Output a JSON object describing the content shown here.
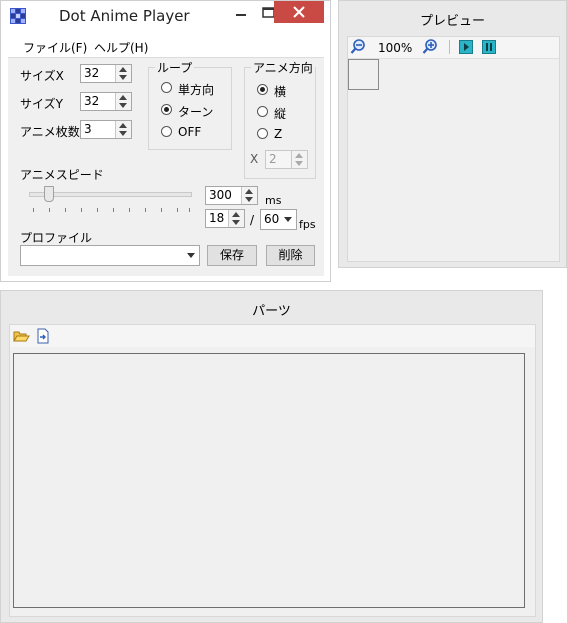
{
  "main": {
    "title": "Dot Anime Player",
    "menu": [
      "ファイル(F)",
      "ヘルプ(H)"
    ],
    "size_x_label": "サイズX",
    "size_x_value": "32",
    "size_y_label": "サイズY",
    "size_y_value": "32",
    "frames_label": "アニメ枚数",
    "frames_value": "3",
    "loop": {
      "title": "ループ",
      "options": [
        "単方向",
        "ターン",
        "OFF"
      ],
      "selected": "ターン"
    },
    "direction": {
      "title": "アニメ方向",
      "options": [
        "横",
        "縦",
        "Z"
      ],
      "selected": "横",
      "x_label": "X",
      "x_value": "2"
    },
    "speed_label": "アニメスピード",
    "ms_value": "300",
    "ms_unit": "ms",
    "frames_per": "18",
    "slash": "/",
    "fps_select": "60",
    "fps_unit": "fps",
    "profile_label": "プロファイル",
    "profile_value": "",
    "save_button": "保存",
    "delete_button": "削除"
  },
  "preview": {
    "title": "プレビュー",
    "zoom": "100%"
  },
  "parts": {
    "title": "パーツ"
  }
}
